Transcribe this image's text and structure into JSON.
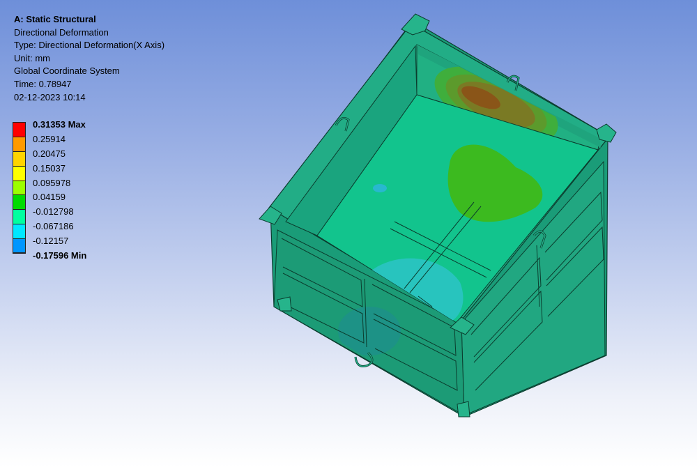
{
  "header": {
    "title": "A: Static Structural",
    "result": "Directional Deformation",
    "type": "Type: Directional Deformation(X Axis)",
    "unit": "Unit: mm",
    "coords": "Global Coordinate System",
    "time": "Time: 0.78947",
    "date": "02-12-2023 10:14"
  },
  "legend": [
    {
      "label": "0.31353 Max",
      "color": "#ff0000",
      "bold": true
    },
    {
      "label": "0.25914",
      "color": "#ff9a00",
      "bold": false
    },
    {
      "label": "0.20475",
      "color": "#ffd400",
      "bold": false
    },
    {
      "label": "0.15037",
      "color": "#ffff00",
      "bold": false
    },
    {
      "label": "0.095978",
      "color": "#9cff00",
      "bold": false
    },
    {
      "label": "0.04159",
      "color": "#00dc00",
      "bold": false
    },
    {
      "label": "-0.012798",
      "color": "#00ffa0",
      "bold": false
    },
    {
      "label": "-0.067186",
      "color": "#00e8ff",
      "bold": false
    },
    {
      "label": "-0.12157",
      "color": "#0096ff",
      "bold": false
    },
    {
      "label": "-0.17596 Min",
      "color": "#0000ff",
      "bold": true
    }
  ],
  "colors": {
    "background_top": "#6e8fd9",
    "background_bottom": "#ffffff",
    "model_base": "#1fa37f",
    "model_floor": "#12c48d"
  }
}
